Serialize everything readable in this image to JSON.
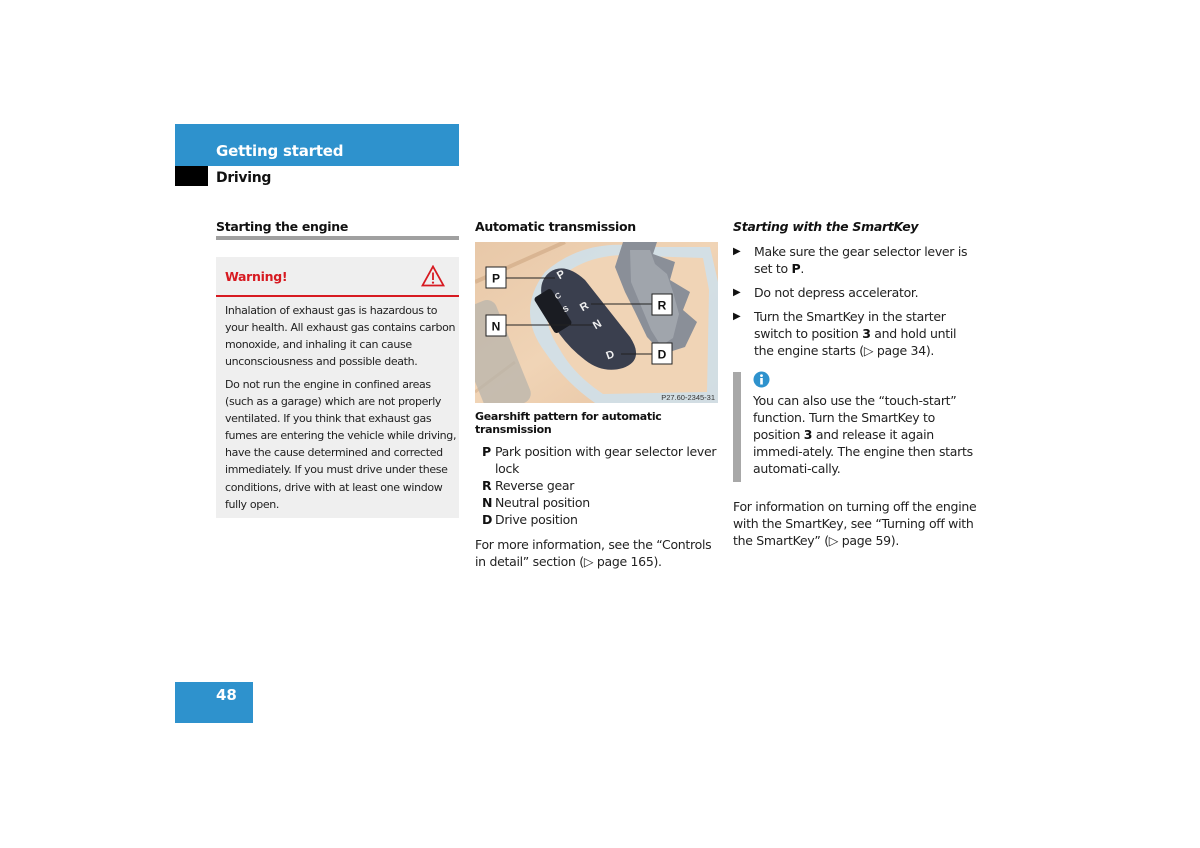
{
  "header": {
    "section_title": "Getting started",
    "subsection_title": "Driving",
    "accent_color": "#2e92cd"
  },
  "column1": {
    "heading": "Starting the engine",
    "warning": {
      "title": "Warning!",
      "icon": "warning-triangle-icon",
      "color": "#d71a21",
      "paragraphs": [
        "Inhalation of exhaust gas is hazardous to your health. All exhaust gas contains carbon monoxide, and inhaling it can cause unconsciousness and possible death.",
        "Do not run the engine in confined areas (such as a garage) which are not properly ventilated. If you think that exhaust gas fumes are entering the vehicle while driving, have the cause determined and corrected immediately. If you must drive under these conditions, drive with at least one window fully open."
      ]
    }
  },
  "column2": {
    "heading": "Automatic transmission",
    "figure": {
      "callouts": [
        "P",
        "R",
        "N",
        "D"
      ],
      "gate_labels": [
        "P",
        "R",
        "N",
        "D",
        "C",
        "S"
      ],
      "image_code": "P27.60-2345-31",
      "caption": "Gearshift pattern for automatic transmission"
    },
    "legend": [
      {
        "key": "P",
        "text": "Park position with gear selector lever lock"
      },
      {
        "key": "R",
        "text": "Reverse gear"
      },
      {
        "key": "N",
        "text": "Neutral position"
      },
      {
        "key": "D",
        "text": "Drive position"
      }
    ],
    "more_info": {
      "before": "For more information, see the “Controls in detail” section (",
      "arrow": "▷",
      "page": " page 165)."
    }
  },
  "column3": {
    "heading": "Starting with the SmartKey",
    "bullets": [
      {
        "arrow": "▶",
        "text_before": "Make sure the gear selector lever is set to ",
        "bold": "P",
        "text_after": "."
      },
      {
        "arrow": "▶",
        "text_before": "Do not depress accelerator.",
        "bold": "",
        "text_after": ""
      },
      {
        "arrow": "▶",
        "text_before": "Turn the SmartKey in the starter switch to position ",
        "bold": "3",
        "text_after": " and hold until the engine starts (▷ page 34)."
      }
    ],
    "info": {
      "icon": "info-icon",
      "text_before": "You can also use the “touch-start” function. Turn the SmartKey to position ",
      "bold": "3",
      "text_after": " and release it again immedi-ately. The engine then starts automati-cally."
    },
    "more_info": "For information on turning off the engine with the SmartKey, see “Turning off with the SmartKey” (▷ page 59)."
  },
  "footer": {
    "page_number": "48"
  }
}
